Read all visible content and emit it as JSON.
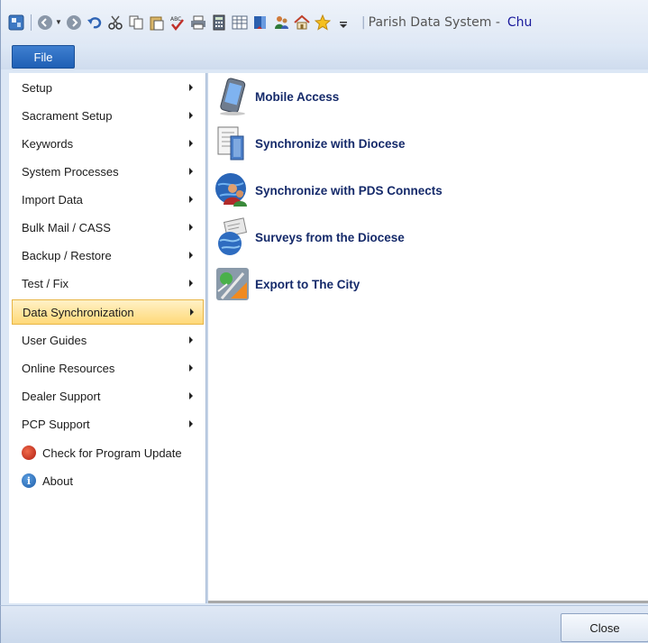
{
  "titlebar": {
    "quick_access_icons": [
      "app-icon",
      "back-icon",
      "forward-icon",
      "undo-icon",
      "cut-icon",
      "copy-icon",
      "paste-icon",
      "spellcheck-icon",
      "print-icon",
      "calculator-icon",
      "table-icon",
      "book-icon",
      "people-icon",
      "home-icon",
      "favorites-star-icon",
      "customize-dropdown-icon"
    ],
    "app_title": "Parish Data System -",
    "app_title_suffix": "Chu"
  },
  "ribbon": {
    "file_tab": "File"
  },
  "left_nav": {
    "items": [
      {
        "label": "Setup",
        "submenu": true,
        "selected": false
      },
      {
        "label": "Sacrament Setup",
        "submenu": true,
        "selected": false
      },
      {
        "label": "Keywords",
        "submenu": true,
        "selected": false
      },
      {
        "label": "System Processes",
        "submenu": true,
        "selected": false
      },
      {
        "label": "Import Data",
        "submenu": true,
        "selected": false
      },
      {
        "label": "Bulk Mail / CASS",
        "submenu": true,
        "selected": false
      },
      {
        "label": "Backup / Restore",
        "submenu": true,
        "selected": false
      },
      {
        "label": "Test / Fix",
        "submenu": true,
        "selected": false
      },
      {
        "label": "Data Synchronization",
        "submenu": true,
        "selected": true
      },
      {
        "label": "User Guides",
        "submenu": true,
        "selected": false
      },
      {
        "label": "Online Resources",
        "submenu": true,
        "selected": false
      },
      {
        "label": "Dealer Support",
        "submenu": true,
        "selected": false
      },
      {
        "label": "PCP Support",
        "submenu": true,
        "selected": false
      },
      {
        "label": "Check for Program Update",
        "icon": "update-icon",
        "submenu": false,
        "selected": false
      },
      {
        "label": "About",
        "icon": "info-icon",
        "submenu": false,
        "selected": false
      }
    ]
  },
  "content": {
    "actions": [
      {
        "label": "Mobile Access",
        "icon": "mobile-device-icon"
      },
      {
        "label": "Synchronize with Diocese",
        "icon": "document-sync-icon"
      },
      {
        "label": "Synchronize with PDS Connects",
        "icon": "globe-people-icon"
      },
      {
        "label": "Surveys from the Diocese",
        "icon": "survey-globe-icon"
      },
      {
        "label": "Export to The City",
        "icon": "city-export-icon"
      }
    ]
  },
  "footer": {
    "close_label": "Close"
  },
  "colors": {
    "accent": "#1e5fb5",
    "selected_bg": "#ffd978",
    "action_text": "#152a6a"
  }
}
